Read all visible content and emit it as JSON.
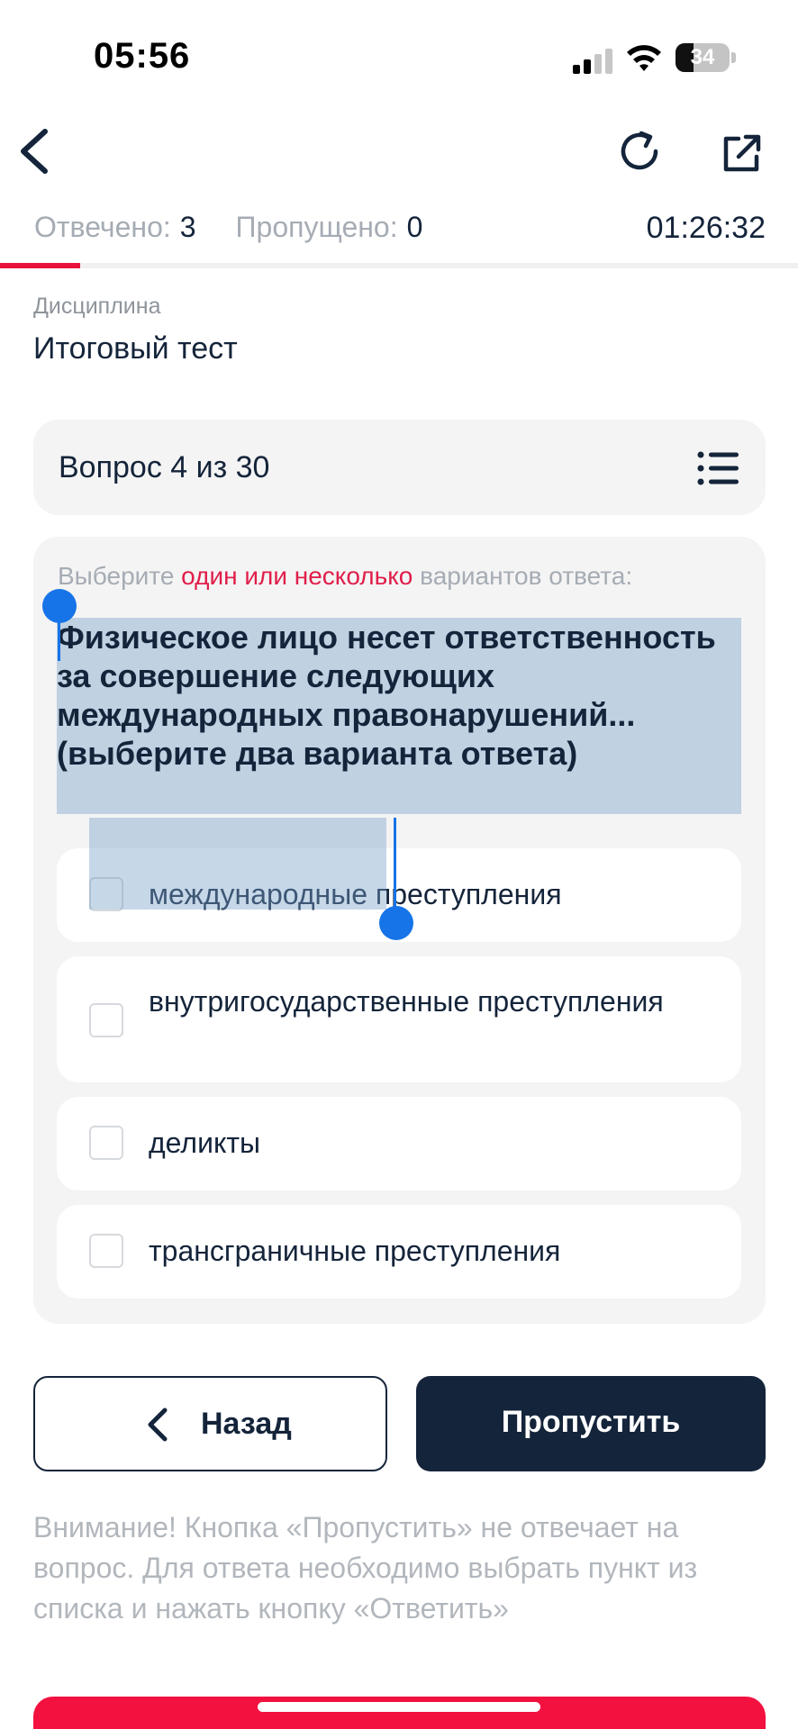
{
  "status_bar": {
    "time": "05:56",
    "battery_level": "34"
  },
  "nav": {
    "back_icon": "chevron-left-icon",
    "refresh_icon": "refresh-icon",
    "share_icon": "external-link-icon"
  },
  "stats": {
    "answered_label": "Отвечено:",
    "answered_value": "3",
    "skipped_label": "Пропущено:",
    "skipped_value": "0",
    "timer": "01:26:32",
    "progress_fraction": 0.1
  },
  "discipline": {
    "label": "Дисциплина",
    "value": "Итоговый тест"
  },
  "question": {
    "counter": "Вопрос 4 из 30",
    "list_icon": "list-icon",
    "instruction_before": "Выберите ",
    "instruction_accent": "один или несколько",
    "instruction_after": " вариантов ответа:",
    "text": "Физическое лицо несет ответственность за совершение следующих международных правонарушений... (выберите два варианта ответа)",
    "options": [
      {
        "label": "международные преступления",
        "checked": false
      },
      {
        "label": "внутригосударственные преступления",
        "checked": false
      },
      {
        "label": "деликты",
        "checked": false
      },
      {
        "label": "трансграничные преступления",
        "checked": false
      }
    ]
  },
  "actions": {
    "back_label": "Назад",
    "skip_label": "Пропустить"
  },
  "warning": "Внимание! Кнопка «Пропустить» не отвечает на вопрос. Для ответа необходимо выбрать пункт из списка и нажать кнопку «Ответить»",
  "colors": {
    "accent": "#e8113d",
    "primary_dark": "#14243a",
    "muted": "#a6acb4",
    "card_bg": "#f4f4f4",
    "selection": "#1674e8"
  }
}
